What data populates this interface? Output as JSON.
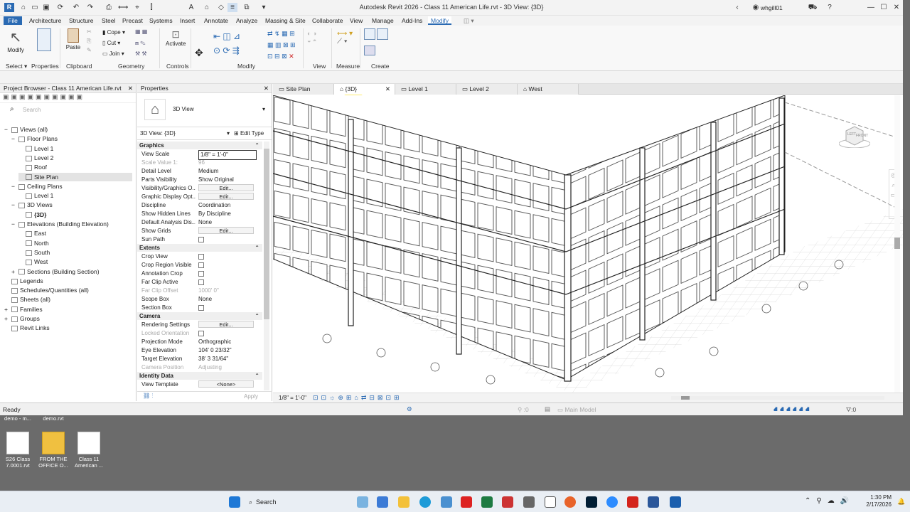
{
  "app": {
    "title": "Autodesk Revit 2026 - Class 11  American Life.rvt - 3D View: {3D}",
    "user": "whgill01"
  },
  "menu": [
    "File",
    "Architecture",
    "Structure",
    "Steel",
    "Precast",
    "Systems",
    "Insert",
    "Annotate",
    "Analyze",
    "Massing & Site",
    "Collaborate",
    "View",
    "Manage",
    "Add-Ins",
    "Modify"
  ],
  "ribbon": {
    "groups": [
      "Select",
      "Properties",
      "Clipboard",
      "Geometry",
      "Controls",
      "Modify",
      "View",
      "Measure",
      "Create"
    ],
    "modify": "Modify",
    "paste": "Paste",
    "cope": "Cope",
    "cut": "Cut",
    "join": "Join",
    "activate": "Activate"
  },
  "project_browser": {
    "title": "Project Browser - Class 11  American Life.rvt",
    "search_placeholder": "Search",
    "items": [
      {
        "label": "Views (all)",
        "lvl": 0,
        "exp": "−"
      },
      {
        "label": "Floor Plans",
        "lvl": 1,
        "exp": "−"
      },
      {
        "label": "Level 1",
        "lvl": 2
      },
      {
        "label": "Level 2",
        "lvl": 2
      },
      {
        "label": "Roof",
        "lvl": 2
      },
      {
        "label": "Site Plan",
        "lvl": 2,
        "sel": true
      },
      {
        "label": "Ceiling Plans",
        "lvl": 1,
        "exp": "−"
      },
      {
        "label": "Level 1",
        "lvl": 2
      },
      {
        "label": "3D Views",
        "lvl": 1,
        "exp": "−"
      },
      {
        "label": "{3D}",
        "lvl": 2,
        "bold": true
      },
      {
        "label": "Elevations (Building Elevation)",
        "lvl": 1,
        "exp": "−"
      },
      {
        "label": "East",
        "lvl": 2
      },
      {
        "label": "North",
        "lvl": 2
      },
      {
        "label": "South",
        "lvl": 2
      },
      {
        "label": "West",
        "lvl": 2
      },
      {
        "label": "Sections (Building Section)",
        "lvl": 1,
        "exp": "+"
      },
      {
        "label": "Legends",
        "lvl": 0
      },
      {
        "label": "Schedules/Quantities (all)",
        "lvl": 0
      },
      {
        "label": "Sheets (all)",
        "lvl": 0
      },
      {
        "label": "Families",
        "lvl": 0,
        "exp": "+"
      },
      {
        "label": "Groups",
        "lvl": 0,
        "exp": "+"
      },
      {
        "label": "Revit Links",
        "lvl": 0
      }
    ]
  },
  "properties": {
    "title": "Properties",
    "type_name": "3D View",
    "instance": "3D View: {3D}",
    "edit_type": "Edit Type",
    "apply": "Apply",
    "rows": [
      {
        "g": "Graphics"
      },
      {
        "k": "View Scale",
        "v": "1/8\" = 1'-0\"",
        "box": true
      },
      {
        "k": "Scale Value    1:",
        "v": "96",
        "dim": true
      },
      {
        "k": "Detail Level",
        "v": "Medium"
      },
      {
        "k": "Parts Visibility",
        "v": "Show Original"
      },
      {
        "k": "Visibility/Graphics O...",
        "v": "Edit...",
        "btn": true
      },
      {
        "k": "Graphic Display Opt...",
        "v": "Edit...",
        "btn": true
      },
      {
        "k": "Discipline",
        "v": "Coordination"
      },
      {
        "k": "Show Hidden Lines",
        "v": "By Discipline"
      },
      {
        "k": "Default Analysis Dis...",
        "v": "None"
      },
      {
        "k": "Show Grids",
        "v": "Edit...",
        "btn": true
      },
      {
        "k": "Sun Path",
        "v": "",
        "cb": true
      },
      {
        "g": "Extents"
      },
      {
        "k": "Crop View",
        "v": "",
        "cb": true
      },
      {
        "k": "Crop Region Visible",
        "v": "",
        "cb": true
      },
      {
        "k": "Annotation Crop",
        "v": "",
        "cb": true
      },
      {
        "k": "Far Clip Active",
        "v": "",
        "cb": true
      },
      {
        "k": "Far Clip Offset",
        "v": "1000'  0\"",
        "dim": true
      },
      {
        "k": "Scope Box",
        "v": "None"
      },
      {
        "k": "Section Box",
        "v": "",
        "cb": true
      },
      {
        "g": "Camera"
      },
      {
        "k": "Rendering Settings",
        "v": "Edit...",
        "btn": true
      },
      {
        "k": "Locked Orientation",
        "v": "",
        "cb": true,
        "dim": true
      },
      {
        "k": "Projection Mode",
        "v": "Orthographic"
      },
      {
        "k": "Eye Elevation",
        "v": "104'  0 23/32\""
      },
      {
        "k": "Target Elevation",
        "v": "38'  3 31/64\""
      },
      {
        "k": "Camera Position",
        "v": "Adjusting",
        "dim": true
      },
      {
        "g": "Identity Data"
      },
      {
        "k": "View Template",
        "v": "<None>",
        "btn": true
      }
    ]
  },
  "tabs": [
    "Site Plan",
    "{3D}",
    "Level 1",
    "Level 2",
    "West"
  ],
  "viewbar": {
    "scale": "1/8\" = 1'-0\""
  },
  "status": {
    "left": "Ready",
    "model": "Main Model",
    "filter": ":0",
    "select": ":0"
  },
  "desktop": [
    {
      "label": "S26 Class 7.0001.rvt",
      "top": "demo - m..."
    },
    {
      "label": "FROM THE OFFICE O...",
      "top": "demo.rvt"
    },
    {
      "label": "Class 11 American ...",
      "top": ""
    }
  ],
  "taskbar": {
    "search": "Search",
    "time": "1:30 PM",
    "date": "2/17/2026"
  },
  "viewcube": {
    "left": "LEFT",
    "front": "FRONT"
  }
}
